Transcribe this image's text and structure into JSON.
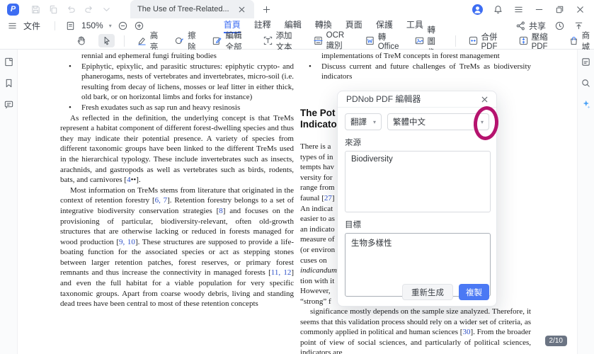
{
  "titlebar": {
    "tab_title": "The Use of Tree-Related...",
    "logo_letter": "P",
    "new_tab_icon": "plus-icon",
    "ghost_icons": [
      "save-icon",
      "copy-icon",
      "undo-icon",
      "redo-icon",
      "caret-down-icon"
    ],
    "window_icons": [
      "avatar-icon",
      "bell-icon",
      "hamburger-icon",
      "minimize-icon",
      "restore-icon",
      "close-icon"
    ]
  },
  "menubar": {
    "file_label": "文件",
    "zoom_value": "150%",
    "share_label": "共享",
    "tabs": [
      {
        "name": "home",
        "label": "首頁",
        "active": true
      },
      {
        "name": "annotate",
        "label": "註釋",
        "active": false
      },
      {
        "name": "edit",
        "label": "編輯",
        "active": false
      },
      {
        "name": "convert",
        "label": "轉換",
        "active": false
      },
      {
        "name": "page",
        "label": "頁面",
        "active": false
      },
      {
        "name": "protect",
        "label": "保護",
        "active": false
      },
      {
        "name": "tools",
        "label": "工具",
        "active": false
      }
    ]
  },
  "toolbar": {
    "items": [
      {
        "type": "tool",
        "name": "hand-tool",
        "icon": "hand-icon",
        "label": "",
        "active": false
      },
      {
        "type": "tool",
        "name": "select-tool",
        "icon": "cursor-icon",
        "label": "",
        "active": true
      },
      {
        "type": "divider"
      },
      {
        "type": "tool",
        "name": "highlight",
        "icon": "highlight-icon",
        "label": "高亮",
        "active": false
      },
      {
        "type": "tool",
        "name": "erase",
        "icon": "erase-icon",
        "label": "擦除",
        "active": false
      },
      {
        "type": "tool",
        "name": "edit-all",
        "icon": "edit-all-icon",
        "label": "編輯全部",
        "active": false
      },
      {
        "type": "tool",
        "name": "add-text",
        "icon": "add-text-icon",
        "label": "添加文本",
        "active": false
      },
      {
        "type": "tool",
        "name": "ocr",
        "icon": "ocr-icon",
        "label": "OCR識別",
        "active": false
      },
      {
        "type": "tool",
        "name": "to-office",
        "icon": "office-icon",
        "label": "轉Office",
        "active": false
      },
      {
        "type": "tool",
        "name": "to-image",
        "icon": "image-icon",
        "label": "轉圖像",
        "active": false
      },
      {
        "type": "divider"
      },
      {
        "type": "tool",
        "name": "merge-pdf",
        "icon": "merge-icon",
        "label": "合併PDF",
        "active": false
      },
      {
        "type": "tool",
        "name": "compress-pdf",
        "icon": "compress-icon",
        "label": "壓縮PDF",
        "active": false
      },
      {
        "type": "tool",
        "name": "store",
        "icon": "store-icon",
        "label": "商城",
        "active": false
      }
    ]
  },
  "sidebar_left": {
    "items": [
      {
        "name": "thumbnails-panel",
        "icon": "thumbnails-icon"
      },
      {
        "name": "bookmarks-panel",
        "icon": "bookmark-icon"
      },
      {
        "name": "comments-panel",
        "icon": "comment-icon"
      }
    ]
  },
  "sidebar_right": {
    "items": [
      {
        "name": "properties-panel",
        "icon": "panel-icon"
      },
      {
        "name": "search-panel",
        "icon": "search-icon"
      },
      {
        "name": "ai-assistant",
        "icon": "sparkle-icon"
      }
    ]
  },
  "document": {
    "bullet_char": "•",
    "left_column": [
      {
        "kind": "cont",
        "segs": [
          [
            "p",
            "rennial and ephemeral fungi fruiting bodies"
          ]
        ]
      },
      {
        "kind": "bullet",
        "segs": [
          [
            "p",
            "Epiphytic, epixylic, and parasitic structures: epiphytic crypto- and phanerogams, nests of vertebrates and invertebrates, micro-soil (i.e. resulting from decay of lichens, mosses or leaf litter in either thick, old bark, or on horizontal limbs and forks for instance)"
          ]
        ]
      },
      {
        "kind": "bullet",
        "segs": [
          [
            "p",
            "Fresh exudates such as sap run and heavy resinosis"
          ]
        ]
      },
      {
        "kind": "para",
        "segs": [
          [
            "p",
            "As reflected in the definition, the underlying concept is that TreMs represent a habitat component of different forest-dwelling species and thus they may indicate their potential presence. A variety of species from different taxonomic groups have been linked to the different TreMs used in the hierarchical typology. These include invertebrates such as insects, arachnids, and gastropods as well as vertebrates such as birds, rodents, bats, and carnivores ["
          ],
          [
            "r",
            "4"
          ],
          [
            "p",
            "••]."
          ]
        ]
      },
      {
        "kind": "para",
        "segs": [
          [
            "p",
            "Most information on TreMs stems from literature that originated in the context of retention forestry ["
          ],
          [
            "r",
            "6, 7"
          ],
          [
            "p",
            "]. Retention forestry belongs to a set of integrative biodiversity conservation strategies ["
          ],
          [
            "r",
            "8"
          ],
          [
            "p",
            "] and focuses on the provisioning of particular, biodiversity-relevant, often old-growth structures that are otherwise lacking or reduced in forests managed for wood production ["
          ],
          [
            "r",
            "9, 10"
          ],
          [
            "p",
            "]. These structures are supposed to provide a life-boating function for the associated species or act as stepping stones between larger retention patches, forest reserves, or primary forest remnants and thus increase the connectivity in managed forests ["
          ],
          [
            "r",
            "11, 12"
          ],
          [
            "p",
            "] and even the full habitat for a viable population for very specific taxonomic groups. Apart from coarse woody debris, living and standing dead trees have been central to most of these retention concepts"
          ]
        ]
      }
    ],
    "right_column_top": [
      {
        "kind": "cont",
        "segs": [
          [
            "p",
            "implementations of TreM concepts in forest management"
          ]
        ]
      },
      {
        "kind": "bullet",
        "segs": [
          [
            "p",
            "Discuss current and future challenges of TreMs as biodiversity indicators"
          ]
        ]
      }
    ],
    "heading_lines": [
      "The Pot",
      "Indicato"
    ],
    "right_column_lines": [
      {
        "segs": [
          [
            "p",
            "There is a"
          ]
        ]
      },
      {
        "segs": [
          [
            "p",
            "types of in"
          ]
        ]
      },
      {
        "segs": [
          [
            "p",
            "tempts hav"
          ]
        ]
      },
      {
        "segs": [
          [
            "p",
            "versity for"
          ]
        ]
      },
      {
        "segs": [
          [
            "p",
            "range from"
          ]
        ]
      },
      {
        "segs": [
          [
            "p",
            "faunal ["
          ],
          [
            "r",
            "27"
          ],
          [
            "p",
            "]"
          ]
        ]
      },
      {
        "segs": [
          [
            "p",
            "An indicat"
          ]
        ]
      },
      {
        "segs": [
          [
            "p",
            "easier to as"
          ]
        ]
      },
      {
        "segs": [
          [
            "p",
            "an indicato"
          ]
        ]
      },
      {
        "segs": [
          [
            "p",
            "measure of"
          ]
        ]
      },
      {
        "segs": [
          [
            "p",
            "(or environ"
          ]
        ]
      },
      {
        "segs": [
          [
            "p",
            "cuses on"
          ]
        ]
      },
      {
        "segs": [
          [
            "i",
            "indicandum"
          ]
        ]
      },
      {
        "segs": [
          [
            "p",
            "tion with it"
          ]
        ]
      },
      {
        "segs": [
          [
            "p",
            "However,"
          ]
        ]
      },
      {
        "segs": [
          [
            "p",
            "“strong” f"
          ]
        ]
      }
    ],
    "right_column_bottom": {
      "segs": [
        [
          "p",
          "significance mostly depends on the sample size analyzed. Therefore, it seems that this validation process should rely on a wider set of criteria, as commonly applied in political and human sciences ["
        ],
        [
          "r",
          "30"
        ],
        [
          "p",
          "]. From the broader point of view of social sciences, and particularly of political sciences, indicators are"
        ]
      ]
    }
  },
  "dialog": {
    "title": "PDNob PDF 編輯器",
    "close_icon": "close-icon",
    "mode_select_value": "翻譯",
    "lang_select_value": "繁體中文",
    "source_label": "來源",
    "source_text": "Biodiversity",
    "target_label": "目標",
    "target_text": "生物多樣性",
    "regenerate_label": "重新生成",
    "copy_label": "複製",
    "annotation_color": "#b5136e"
  },
  "statusbar": {
    "page_indicator": "2/10"
  }
}
